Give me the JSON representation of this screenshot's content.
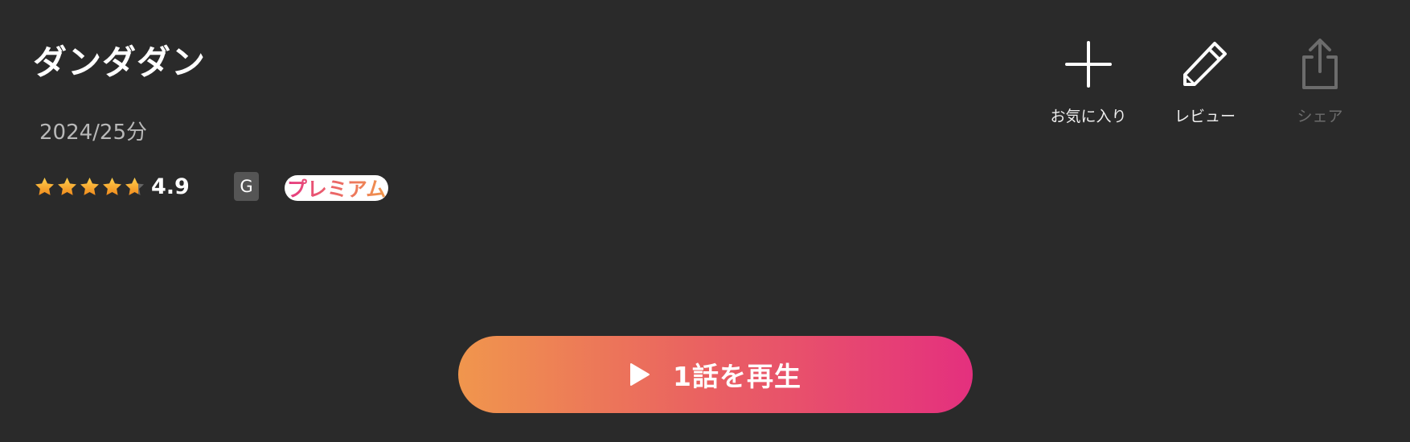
{
  "title": "ダンダダン",
  "meta": "2024/25分",
  "rating": {
    "value": "4.9",
    "stars": 4.9,
    "max_stars": 5
  },
  "age_rating": "G",
  "premium_badge": "プレミアム",
  "actions": {
    "favorite": {
      "label": "お気に入り",
      "icon": "plus-icon"
    },
    "review": {
      "label": "レビュー",
      "icon": "pencil-icon"
    },
    "share": {
      "label": "シェア",
      "icon": "share-icon",
      "disabled": true
    }
  },
  "play_button": {
    "label": "1話を再生",
    "icon": "play-icon"
  },
  "colors": {
    "background": "#2a2a2a",
    "accent_start": "#f0964d",
    "accent_end": "#e4307e",
    "star": "#f5a623",
    "disabled": "#6c6c6c"
  }
}
